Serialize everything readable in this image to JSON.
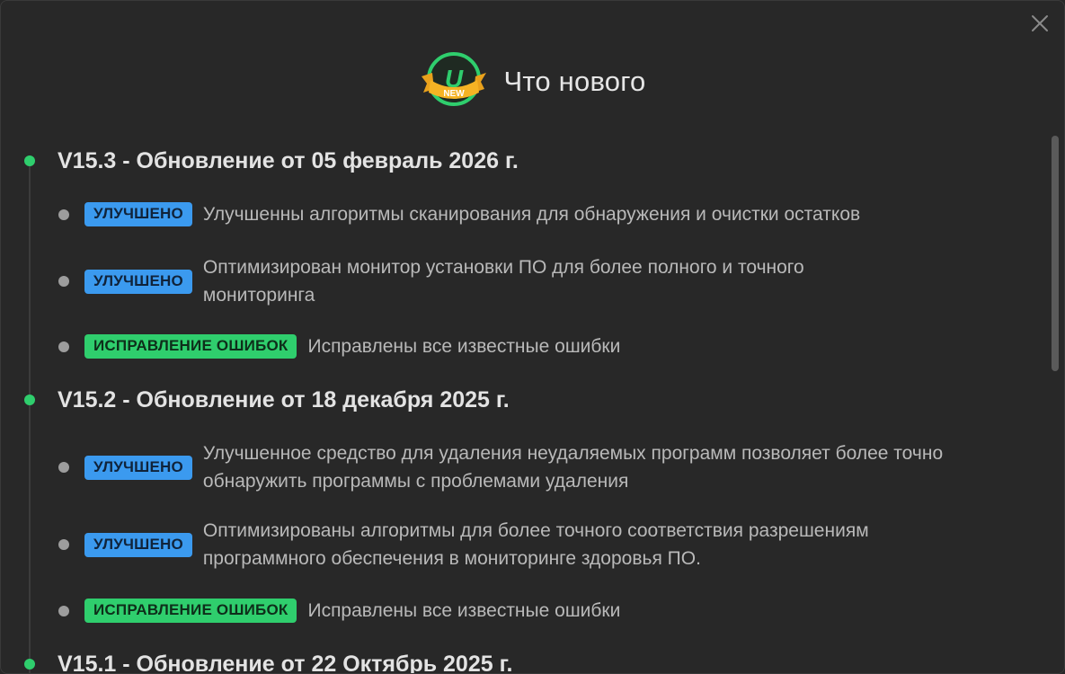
{
  "window": {
    "title": "Что нового",
    "logo_badge_text": "NEW"
  },
  "colors": {
    "background": "#282828",
    "accent_green": "#2fce6d",
    "tag_improved": "#3b9aef",
    "tag_bugfix": "#2fce6d"
  },
  "versions": [
    {
      "title": "V15.3 - Обновление от 05 февраль 2026 г.",
      "items": [
        {
          "tag": "УЛУЧШЕНО",
          "type": "improved",
          "text": "Улучшенны алгоритмы сканирования для обнаружения и очистки остатков"
        },
        {
          "tag": "УЛУЧШЕНО",
          "type": "improved",
          "text": "Оптимизирован монитор установки ПО для более полного и точного мониторинга"
        },
        {
          "tag": "ИСПРАВЛЕНИЕ ОШИБОК",
          "type": "bugfix",
          "text": "Исправлены все известные ошибки"
        }
      ]
    },
    {
      "title": "V15.2 - Обновление от 18 декабря 2025 г.",
      "items": [
        {
          "tag": "УЛУЧШЕНО",
          "type": "improved",
          "text": "Улучшенное средство для удаления неудаляемых программ позволяет более точно обнаружить программы с проблемами удаления"
        },
        {
          "tag": "УЛУЧШЕНО",
          "type": "improved",
          "text": "Оптимизированы алгоритмы для более точного соответствия разрешениям программного обеспечения в мониторинге здоровья ПО."
        },
        {
          "tag": "ИСПРАВЛЕНИЕ ОШИБОК",
          "type": "bugfix",
          "text": "Исправлены все известные ошибки"
        }
      ]
    },
    {
      "title": "V15.1 - Обновление от 22 Октябрь 2025 г.",
      "items": []
    }
  ]
}
